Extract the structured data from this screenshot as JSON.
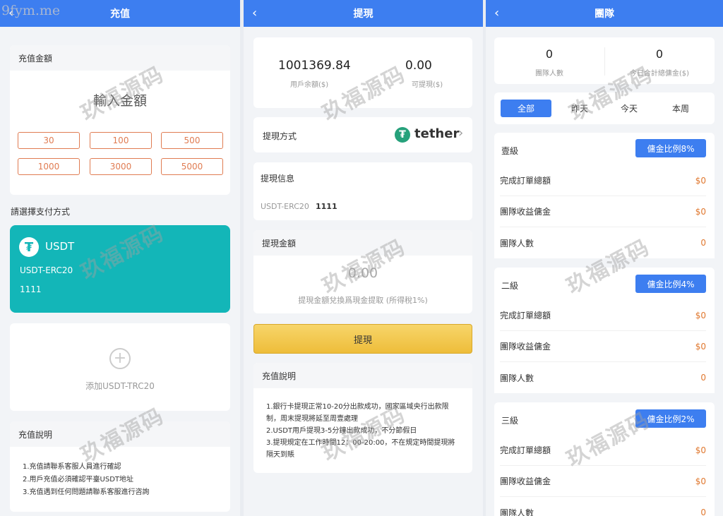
{
  "watermark_top": "9fym.me",
  "watermark_text": "玖福源码",
  "recharge": {
    "title": "充值",
    "amount_label": "充值金額",
    "amount_placeholder": "輸入金額",
    "amounts": [
      "30",
      "100",
      "500",
      "1000",
      "3000",
      "5000"
    ],
    "pay_method_label": "請選擇支付方式",
    "usdt_card": {
      "name": "USDT",
      "network": "USDT-ERC20",
      "address": "1111"
    },
    "add_label": "添加USDT-TRC20",
    "notes_title": "充值說明",
    "notes": [
      "1.充值請聯系客服人員進行確認",
      "2.用戶充值必須確認平臺USDT地址",
      "3.充值遇到任何問題請聯系客服進行咨詢"
    ]
  },
  "withdraw": {
    "title": "提現",
    "balance_value": "1001369.84",
    "balance_label": "用戶余額($)",
    "available_value": "0.00",
    "available_label": "可提現($)",
    "method_label": "提現方式",
    "method_brand": "tether",
    "info_label": "提現信息",
    "info_network": "USDT-ERC20",
    "info_address": "1111",
    "amount_label": "提現金額",
    "amount_value": "0.00",
    "amount_hint": "提現金額兌換爲現金提取 (所得稅1%)",
    "submit_label": "提現",
    "notes_title": "充值說明",
    "notes": [
      "1.銀行卡提現正常10-20分出款成功，國家區域央行出款限制，周末提現將延至周壹處理",
      "2.USDT用戶提現3-5分鐘出款成功，不分節假日",
      "3.提現規定在工作時間12：00-20:00，不在規定時間提現將隔天到賬"
    ]
  },
  "team": {
    "title": "團隊",
    "count_value": "0",
    "count_label": "團隊人數",
    "commission_value": "0",
    "commission_label": "今日合計總傭金($)",
    "tabs": [
      "全部",
      "昨天",
      "今天",
      "本周"
    ],
    "levels": [
      {
        "name": "壹級",
        "ratio": "傭金比例8%",
        "rows": [
          {
            "label": "完成訂單總額",
            "value": "$0"
          },
          {
            "label": "團隊收益傭金",
            "value": "$0"
          },
          {
            "label": "團隊人數",
            "value": "0"
          }
        ]
      },
      {
        "name": "二級",
        "ratio": "傭金比例4%",
        "rows": [
          {
            "label": "完成訂單總額",
            "value": "$0"
          },
          {
            "label": "團隊收益傭金",
            "value": "$0"
          },
          {
            "label": "團隊人數",
            "value": "0"
          }
        ]
      },
      {
        "name": "三級",
        "ratio": "傭金比例2%",
        "rows": [
          {
            "label": "完成訂單總額",
            "value": "$0"
          },
          {
            "label": "團隊收益傭金",
            "value": "$0"
          },
          {
            "label": "團隊人數",
            "value": "0"
          }
        ]
      }
    ]
  },
  "colors": {
    "primary": "#3d7ef0",
    "teal": "#13b6b8",
    "orange": "#e07c52",
    "gold": "#f2c447",
    "tether": "#26a17b"
  }
}
